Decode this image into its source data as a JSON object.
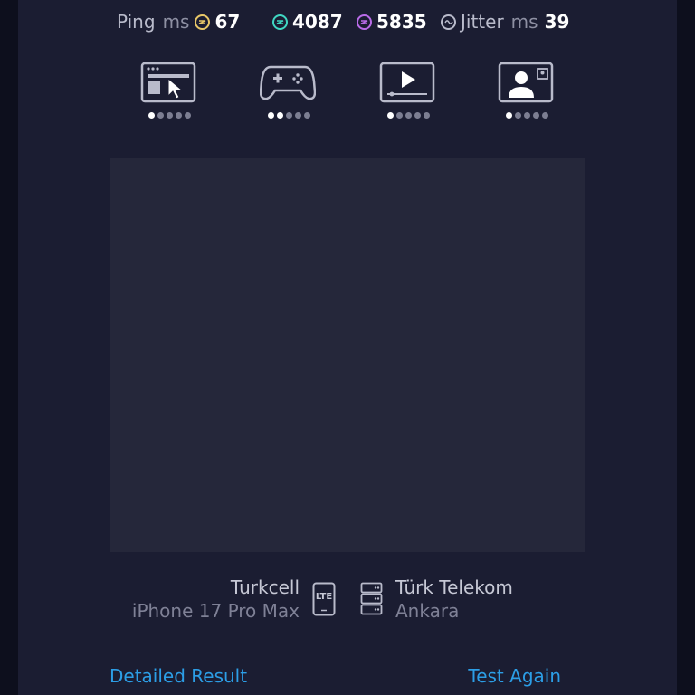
{
  "stats": {
    "ping_label": "Ping",
    "ping_unit": "ms",
    "ping_value": "67",
    "download_value": "4087",
    "upload_value": "5835",
    "jitter_label": "Jitter",
    "jitter_unit": "ms",
    "jitter_value": "39"
  },
  "quality": [
    {
      "name": "browsing-icon",
      "level": 1,
      "max": 5
    },
    {
      "name": "gaming-icon",
      "level": 2,
      "max": 5
    },
    {
      "name": "streaming-icon",
      "level": 1,
      "max": 5
    },
    {
      "name": "video-call-icon",
      "level": 1,
      "max": 5
    }
  ],
  "provider": {
    "carrier": "Turkcell",
    "device": "iPhone 17 Pro Max",
    "connection_badge": "LTE",
    "server_provider": "Türk Telekom",
    "server_city": "Ankara"
  },
  "actions": {
    "detailed_result": "Detailed Result",
    "test_again": "Test Again"
  },
  "colors": {
    "ping_icon": "#e8c768",
    "download_icon": "#3fd6c2",
    "upload_icon": "#b96be8",
    "jitter_icon": "#b9bbcb",
    "link": "#2c9ee6",
    "panel": "#1b1d32"
  }
}
